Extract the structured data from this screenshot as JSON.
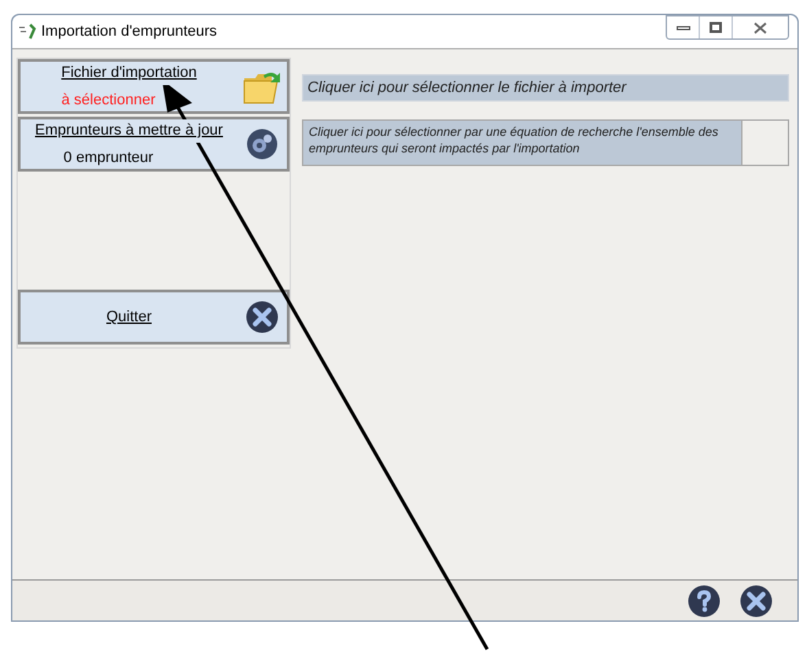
{
  "window": {
    "title": "Importation d'emprunteurs"
  },
  "actions": [
    {
      "title": "Fichier d'importation",
      "subtitle": "à sélectionner",
      "color": "#ff2020"
    },
    {
      "title": "Emprunteurs à mettre à jour",
      "subtitle": "0 emprunteur",
      "color": "#000000"
    }
  ],
  "quit_button": {
    "label": "Quitter"
  },
  "hints": [
    "Cliquer ici pour sélectionner le fichier à importer",
    "Cliquer ici pour sélectionner par une équation de recherche l'ensemble des emprunteurs qui seront impactés par l'importation"
  ]
}
